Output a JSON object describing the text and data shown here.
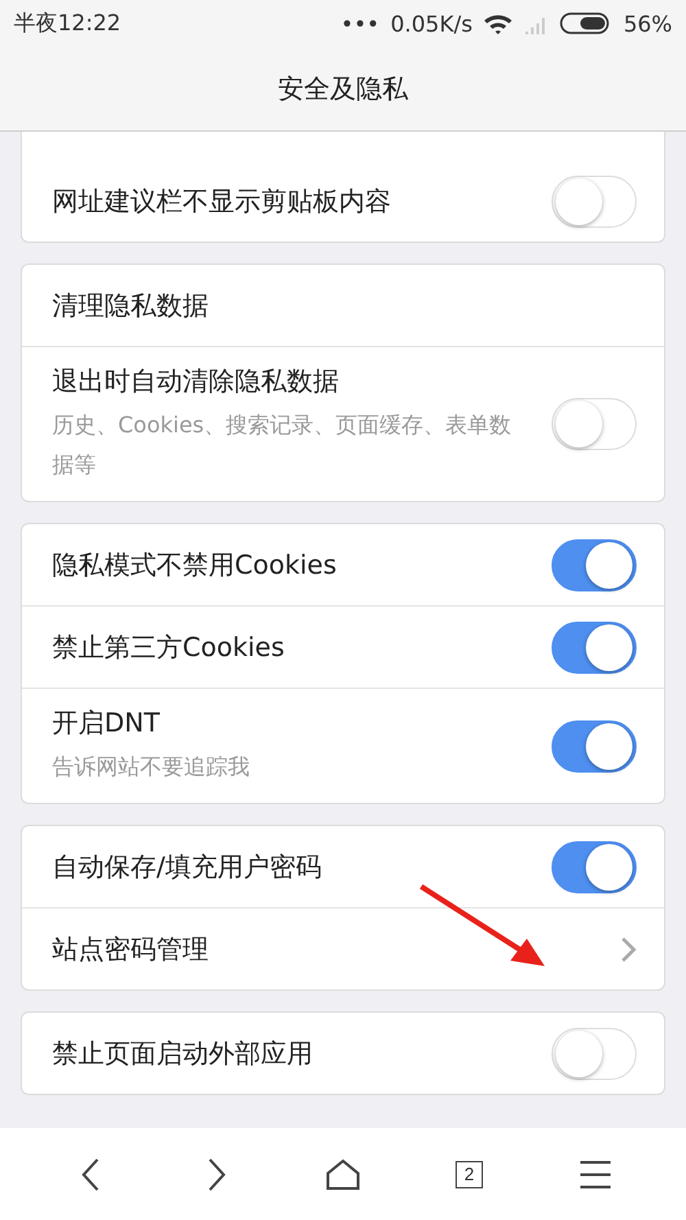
{
  "status_bar": {
    "time": "半夜12:22",
    "dots": "•••",
    "speed": "0.05K/s",
    "battery": "56%"
  },
  "header": {
    "title": "安全及隐私"
  },
  "sections": [
    {
      "rows": [
        {
          "kind": "toggle",
          "label": "网址建议栏不显示剪贴板内容",
          "on": false
        }
      ]
    },
    {
      "rows": [
        {
          "kind": "title",
          "label": "清理隐私数据"
        },
        {
          "kind": "toggle",
          "label": "退出时自动清除隐私数据",
          "hint": "历史、Cookies、搜索记录、页面缓存、表单数据等",
          "on": false
        }
      ]
    },
    {
      "rows": [
        {
          "kind": "toggle",
          "label": "隐私模式不禁用Cookies",
          "on": true
        },
        {
          "kind": "toggle",
          "label": "禁止第三方Cookies",
          "on": true
        },
        {
          "kind": "toggle",
          "label": "开启DNT",
          "hint": "告诉网站不要追踪我",
          "on": true
        }
      ]
    },
    {
      "rows": [
        {
          "kind": "toggle",
          "label": "自动保存/填充用户密码",
          "on": true
        },
        {
          "kind": "link",
          "label": "站点密码管理"
        }
      ]
    },
    {
      "rows": [
        {
          "kind": "toggle",
          "label": "禁止页面启动外部应用",
          "on": false
        }
      ]
    }
  ],
  "bottom_nav": {
    "tab_count": "2"
  }
}
